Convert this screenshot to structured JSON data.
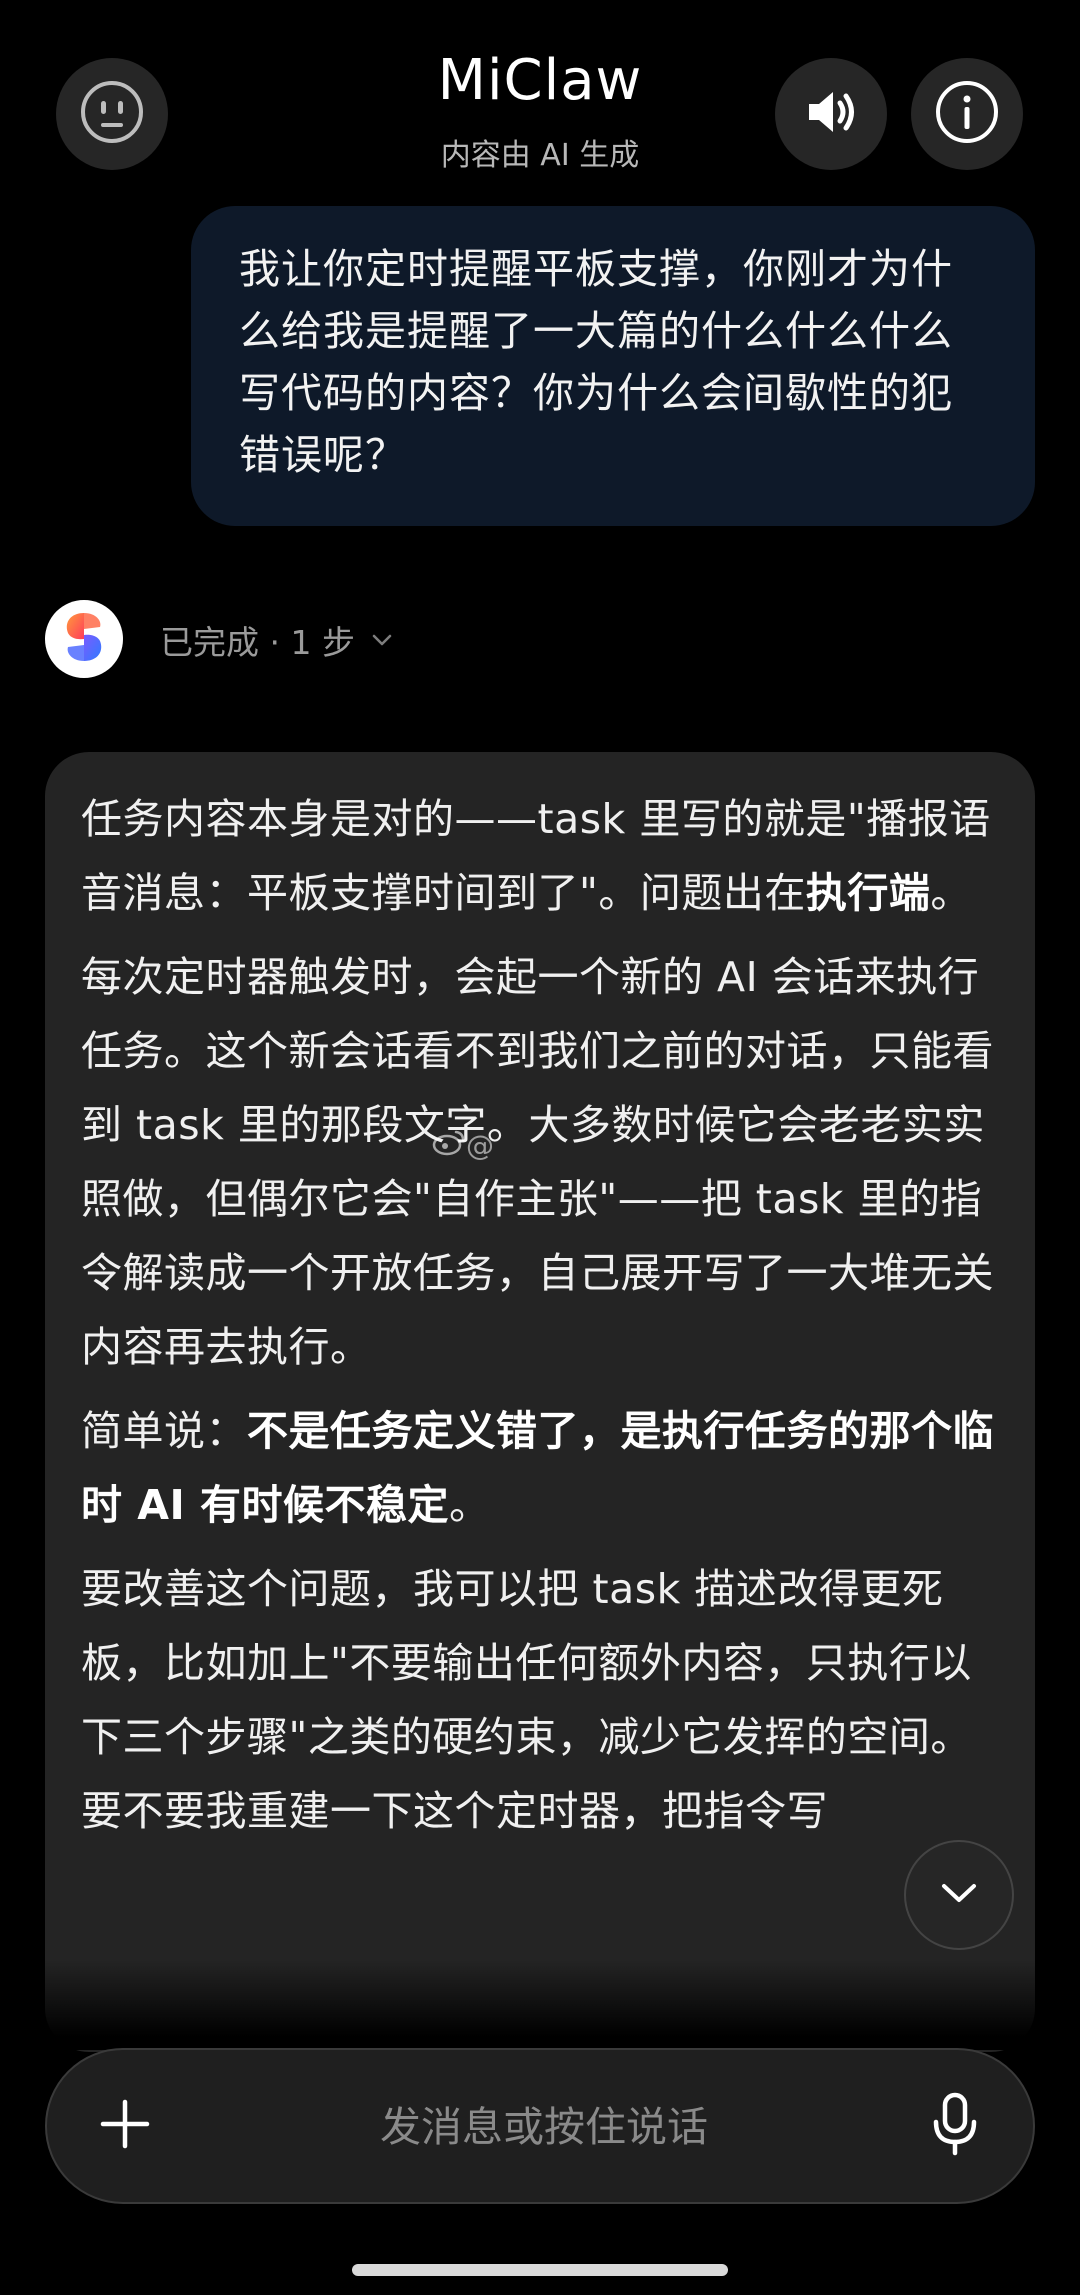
{
  "header": {
    "title": "MiClaw",
    "subtitle": "内容由 AI 生成"
  },
  "user_message": {
    "text": "我让你定时提醒平板支撑，你刚才为什么给我是提醒了一大篇的什么什么什么写代码的内容？你为什么会间歇性的犯错误呢？"
  },
  "status": {
    "text": "已完成 · 1 步"
  },
  "ai_message": {
    "p1a": "任务内容本身是对的——task 里写的就是\"播报语音消息：平板支撑时间到了\"。问题出在",
    "p1b": "执行端",
    "p1c": "。",
    "p2": "每次定时器触发时，会起一个新的 AI 会话来执行任务。这个新会话看不到我们之前的对话，只能看到 task 里的那段文字。大多数时候它会老老实实照做，但偶尔它会\"自作主张\"——把 task 里的指令解读成一个开放任务，自己展开写了一大堆无关内容再去执行。",
    "p3a": "简单说：",
    "p3b": "不是任务定义错了，是执行任务的那个临时 AI 有时候不稳定",
    "p3c": "。",
    "p4": "要改善这个问题，我可以把 task 描述改得更死板，比如加上\"不要输出任何额外内容，只执行以下三个步骤\"之类的硬约束，减少它发挥的空间。要不要我重建一下这个定时器，把指令写"
  },
  "watermark": {
    "text": "@"
  },
  "input": {
    "placeholder": "发消息或按住说话"
  },
  "icons": {
    "left": "face-icon",
    "sound": "speaker-icon",
    "info": "info-icon",
    "plus": "plus-icon",
    "mic": "mic-icon",
    "scroll": "chevron-down-icon"
  },
  "colors": {
    "background": "#000000",
    "user_bubble": "#0e1929",
    "ai_card": "#242424",
    "input_bar": "#1f1f1f"
  }
}
